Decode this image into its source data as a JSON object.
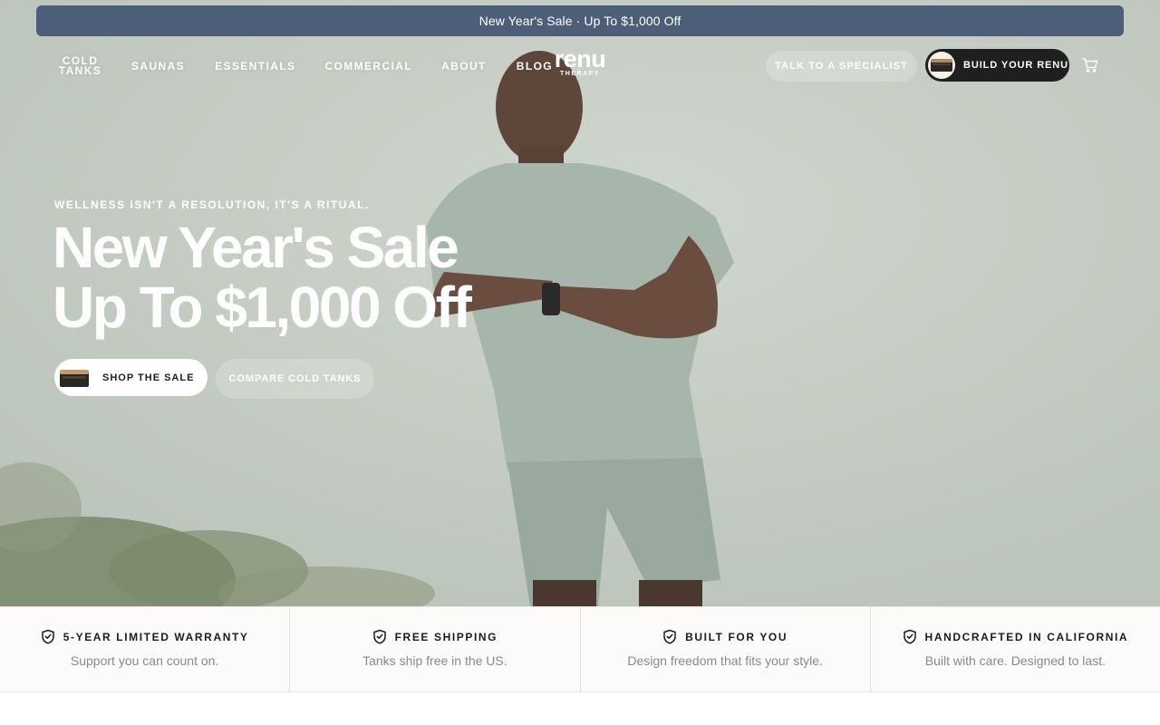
{
  "promo_bar": {
    "text": "New Year's Sale · Up To $1,000 Off"
  },
  "nav": {
    "items": [
      {
        "label": "COLD TANKS"
      },
      {
        "label": "SAUNAS"
      },
      {
        "label": "ESSENTIALS"
      },
      {
        "label": "COMMERCIAL"
      },
      {
        "label": "ABOUT"
      },
      {
        "label": "BLOG"
      }
    ],
    "logo": {
      "word": "renu",
      "sub": "THERAPY"
    },
    "talk_button": "TALK TO A SPECIALIST",
    "build_button": "BUILD YOUR RENU",
    "cart_icon": "cart-icon"
  },
  "hero": {
    "eyebrow": "WELLNESS ISN'T A RESOLUTION, IT'S A RITUAL.",
    "headline_line1": "New Year's Sale",
    "headline_line2": "Up To $1,000 Off",
    "primary_cta": "SHOP THE SALE",
    "secondary_cta": "COMPARE COLD TANKS"
  },
  "features": [
    {
      "icon": "shield-check-icon",
      "title": "5-YEAR LIMITED WARRANTY",
      "desc": "Support you can count on."
    },
    {
      "icon": "shield-check-icon",
      "title": "FREE SHIPPING",
      "desc": "Tanks ship free in the US."
    },
    {
      "icon": "shield-check-icon",
      "title": "BUILT FOR YOU",
      "desc": "Design freedom that fits your style."
    },
    {
      "icon": "shield-check-icon",
      "title": "HANDCRAFTED IN CALIFORNIA",
      "desc": "Built with care. Designed to last."
    }
  ],
  "colors": {
    "promo_bg": "#4c5e78",
    "build_button_bg": "#1f1f1f",
    "features_bg": "#fcfbf9"
  }
}
